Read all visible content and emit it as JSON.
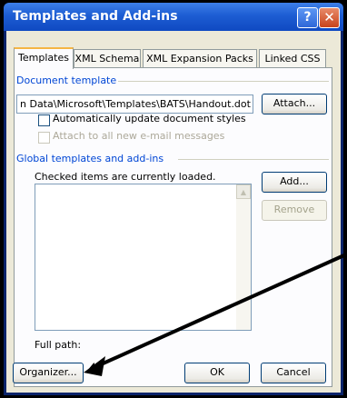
{
  "dialog": {
    "title": "Templates and Add-ins",
    "help_glyph": "?",
    "close_glyph": "✕"
  },
  "tabs": [
    {
      "label": "Templates",
      "active": true
    },
    {
      "label": "XML Schema",
      "active": false
    },
    {
      "label": "XML Expansion Packs",
      "active": false
    },
    {
      "label": "Linked CSS",
      "active": false
    }
  ],
  "document_template": {
    "group_label": "Document template",
    "path": "n Data\\Microsoft\\Templates\\BATS\\Handout.dot",
    "attach_label": "Attach...",
    "auto_update_label": "Automatically update document styles",
    "auto_update_checked": false,
    "attach_email_label": "Attach to all new e-mail messages",
    "attach_email_checked": false,
    "attach_email_disabled": true
  },
  "global_templates": {
    "group_label": "Global templates and add-ins",
    "hint": "Checked items are currently loaded.",
    "add_label": "Add...",
    "remove_label": "Remove",
    "remove_disabled": true,
    "full_path_label": "Full path:",
    "items": []
  },
  "footer": {
    "organizer_label": "Organizer...",
    "ok_label": "OK",
    "cancel_label": "Cancel"
  },
  "annotation": {
    "arrow_color": "#000000"
  }
}
